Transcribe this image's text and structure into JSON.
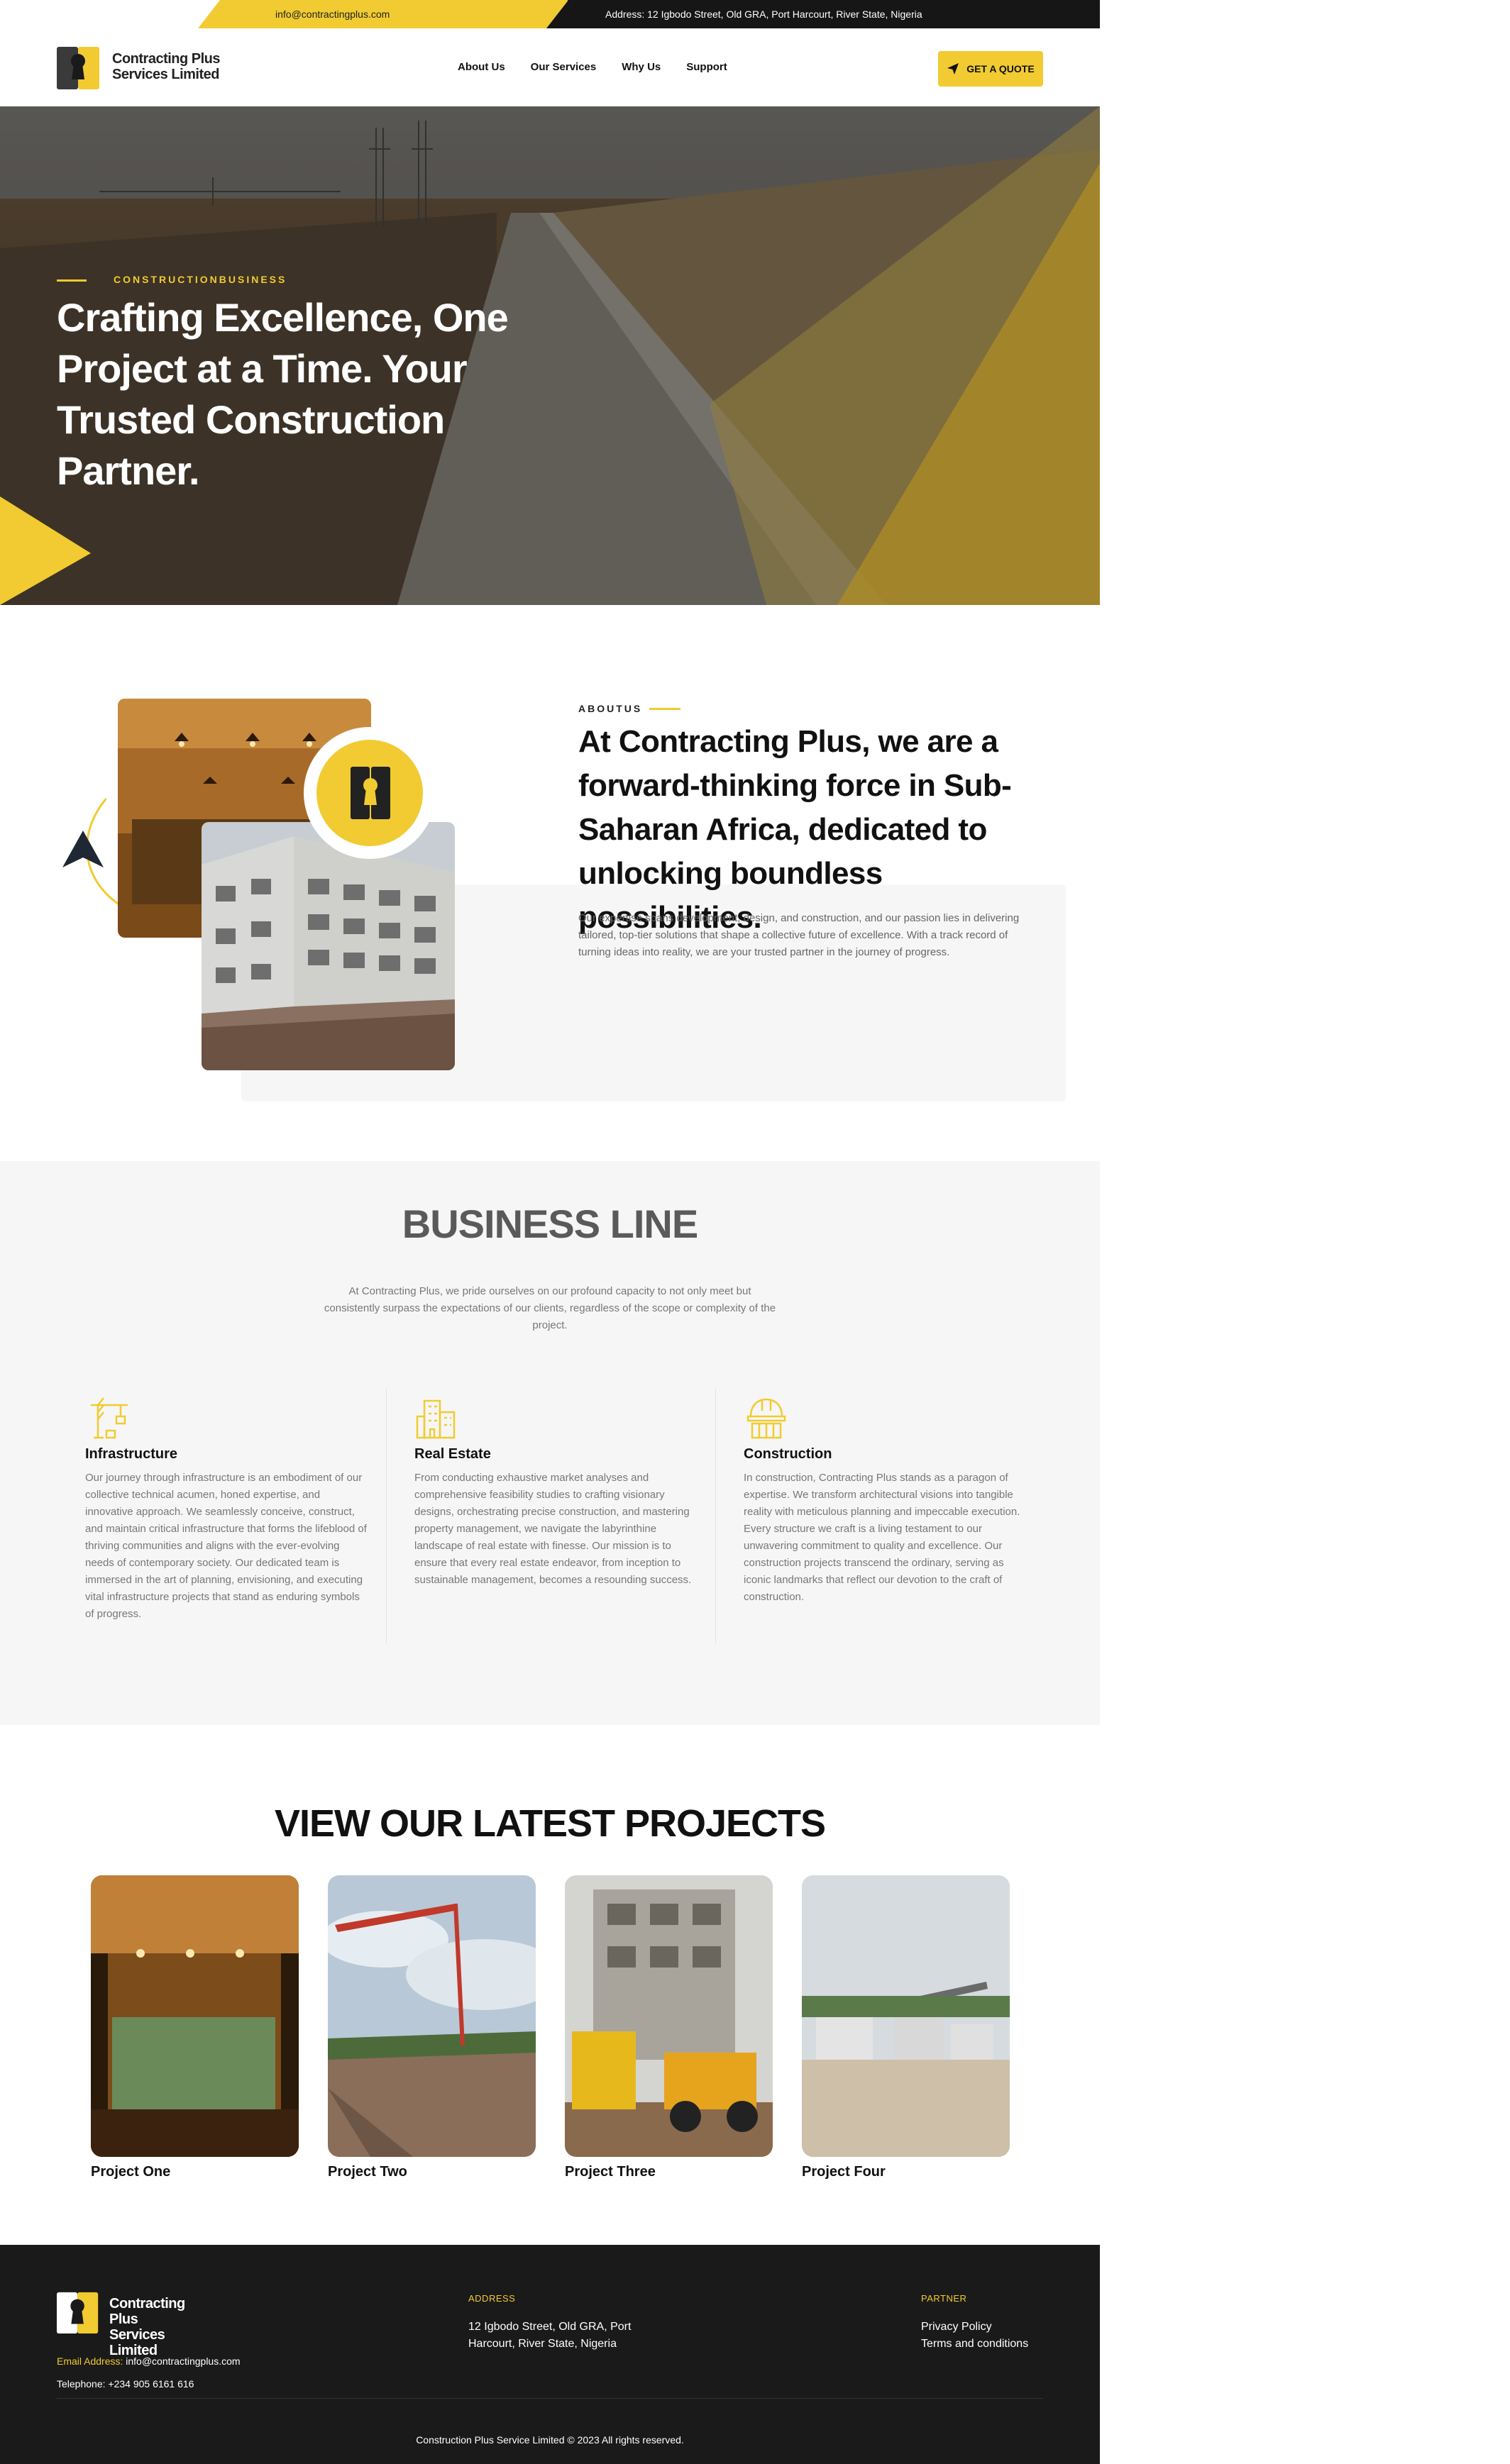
{
  "topbar": {
    "email": "info@contractingplus.com",
    "address": "Address: 12 Igbodo Street, Old GRA, Port Harcourt, River State, Nigeria"
  },
  "brand": {
    "name_line1": "Contracting Plus",
    "name_line2": "Services Limited",
    "accent": "#f1cb31",
    "dark": "#1a1a1a"
  },
  "nav": {
    "items": [
      {
        "label": "About Us"
      },
      {
        "label": "Our Services"
      },
      {
        "label": "Why Us"
      },
      {
        "label": "Support"
      }
    ],
    "cta": "GET A QUOTE",
    "cta_icon": "send-icon"
  },
  "hero": {
    "eyebrow": "CONSTRUCTIONBUSINESS",
    "title": "Crafting Excellence, One Project at a Time. Your Trusted Construction Partner."
  },
  "about": {
    "label": "ABOUTUS",
    "title": "At Contracting Plus, we are a forward-thinking force in Sub-Saharan Africa, dedicated to unlocking boundless possibilities.",
    "body": "Our expertise spans development, design, and construction, and our passion lies in delivering tailored, top-tier solutions that shape a collective future of excellence. With a track record of turning ideas into reality, we are your trusted partner in the journey of progress."
  },
  "business": {
    "title": "BUSINESS LINE",
    "intro": "At Contracting Plus, we pride ourselves on our profound capacity to not only meet but consistently surpass the expectations of our clients, regardless of the scope or complexity of the project.",
    "items": [
      {
        "icon": "crane-icon",
        "title": "Infrastructure",
        "body": "Our journey through infrastructure is an embodiment of our collective technical acumen, honed expertise, and innovative approach. We seamlessly conceive, construct, and maintain critical infrastructure that forms the lifeblood of thriving communities and aligns with the ever-evolving needs of contemporary society. Our dedicated team is immersed in the art of planning, envisioning, and executing vital infrastructure projects that stand as enduring symbols of progress."
      },
      {
        "icon": "building-icon",
        "title": "Real Estate",
        "body": "From conducting exhaustive market analyses and comprehensive feasibility studies to crafting visionary designs, orchestrating precise construction, and mastering property management, we navigate the labyrinthine landscape of real estate with finesse. Our mission is to ensure that every real estate endeavor, from inception to sustainable management, becomes a resounding success."
      },
      {
        "icon": "hardhat-icon",
        "title": "Construction",
        "body": "In construction, Contracting Plus stands as a paragon of expertise. We transform architectural visions into tangible reality with meticulous planning and impeccable execution. Every structure we craft is a living testament to our unwavering commitment to quality and excellence. Our construction projects transcend the ordinary, serving as iconic landmarks that reflect our devotion to the craft of construction."
      }
    ]
  },
  "projects": {
    "title": "VIEW OUR LATEST PROJECTS",
    "items": [
      {
        "name": "Project One"
      },
      {
        "name": "Project Two"
      },
      {
        "name": "Project Three"
      },
      {
        "name": "Project Four"
      }
    ]
  },
  "footer": {
    "email_label": "Email Address:",
    "email": "info@contractingplus.com",
    "phone": "Telephone: +234 905 6161 616",
    "address_heading": "ADDRESS",
    "address": "12 Igbodo Street, Old GRA, Port Harcourt, River State, Nigeria",
    "partner_heading": "PARTNER",
    "links": [
      "Privacy Policy",
      "Terms and conditions"
    ],
    "copyright": "Construction Plus Service Limited © 2023 All rights reserved."
  }
}
